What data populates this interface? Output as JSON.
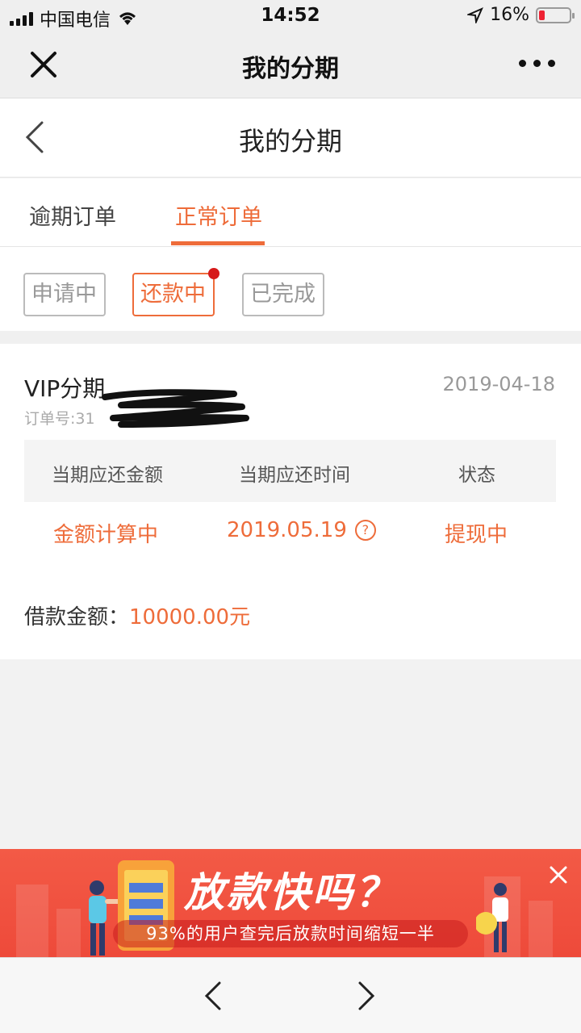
{
  "status_bar": {
    "carrier": "中国电信",
    "time": "14:52",
    "battery": "16%",
    "battery_color": "#e22233"
  },
  "top_nav": {
    "title": "我的分期"
  },
  "page_header": {
    "title": "我的分期"
  },
  "tabs": [
    {
      "label": "逾期订单",
      "active": false
    },
    {
      "label": "正常订单",
      "active": true
    }
  ],
  "filters": [
    {
      "label": "申请中",
      "active": false
    },
    {
      "label": "还款中",
      "active": true,
      "badge": true
    },
    {
      "label": "已完成",
      "active": false
    }
  ],
  "order": {
    "name": "VIP分期",
    "date": "2019-04-18",
    "order_no_label": "订单号:31",
    "table_headers": [
      "当期应还金额",
      "当期应还时间",
      "状态"
    ],
    "amount_value": "金额计算中",
    "due_date": "2019.05.19",
    "help_symbol": "?",
    "status": "提现中",
    "loan_label": "借款金额：",
    "loan_amount": "10000.00元"
  },
  "banner": {
    "headline": "放款快吗？",
    "subtext": "93%的用户查完后放款时间缩短一半"
  },
  "colors": {
    "accent": "#ee6c3a",
    "badge": "#d61a1a",
    "banner": "#f35a46"
  }
}
